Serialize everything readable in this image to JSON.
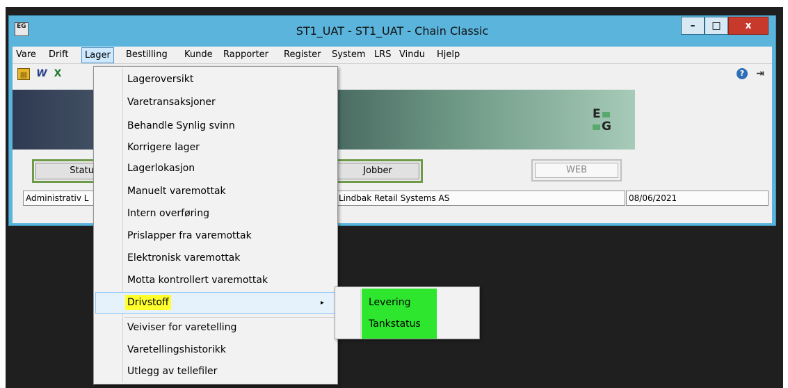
{
  "window": {
    "title": "ST1_UAT  -  ST1_UAT  -  Chain Classic",
    "app_icon_text": "EG",
    "minimize": "–",
    "maximize": "□",
    "close": "x"
  },
  "menubar": {
    "items": [
      "Vare",
      "Drift",
      "Lager",
      "Bestilling",
      "Kunde",
      "Rapporter",
      "Register",
      "System",
      "LRS",
      "Vindu",
      "Hjelp"
    ],
    "active_item": "Lager"
  },
  "toolbar": {
    "icons": [
      "calculator-icon",
      "word-icon",
      "excel-icon",
      "help-icon",
      "exit-door-icon"
    ],
    "icon_glyphs": [
      "▦",
      "W",
      "X",
      "?",
      "⇥"
    ]
  },
  "banner": {
    "logo_top": "E",
    "logo_bottom": "G"
  },
  "buttons": {
    "status": "Status",
    "jobber": "Jobber",
    "web": "WEB"
  },
  "statusbar": {
    "user": "Administrativ L",
    "company": "Lindbak Retail Systems AS",
    "date": "08/06/2021"
  },
  "lager_menu": {
    "items": [
      "Lageroversikt",
      "Varetransaksjoner",
      "Behandle Synlig svinn",
      "Korrigere lager",
      "Lagerlokasjon",
      "Manuelt varemottak",
      "Intern overføring",
      "Prislapper fra varemottak",
      "Elektronisk varemottak",
      "Motta kontrollert varemottak",
      "Drivstoff",
      "Veiviser for varetelling",
      "Varetellingshistorikk",
      "Utlegg av tellefiler"
    ],
    "highlighted_item": "Drivstoff",
    "submenu_arrow": "▸"
  },
  "drivstoff_submenu": {
    "items": [
      "Levering",
      "Tankstatus"
    ]
  },
  "colors": {
    "titlebar": "#5ab4dc",
    "highlight_yellow": "#ffff2e",
    "highlight_green": "#2ee62e",
    "close_button": "#c7392b"
  }
}
